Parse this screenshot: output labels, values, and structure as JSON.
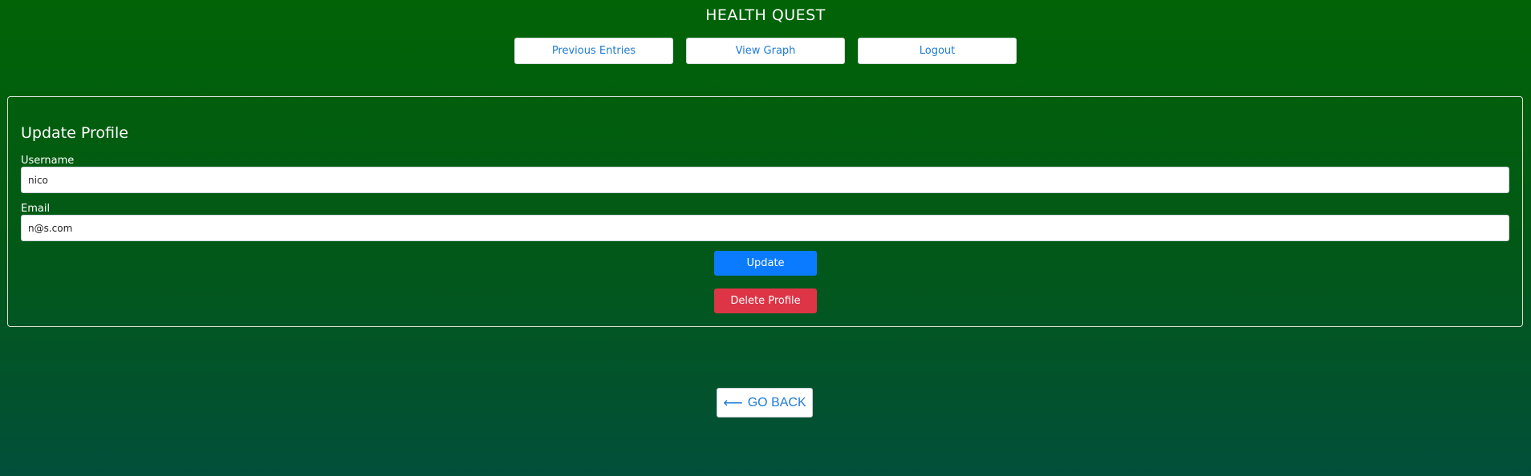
{
  "app": {
    "title": "HEALTH QUEST"
  },
  "nav": {
    "items": [
      {
        "label": "Previous Entries"
      },
      {
        "label": "View Graph"
      },
      {
        "label": "Logout"
      }
    ]
  },
  "profile_form": {
    "title": "Update Profile",
    "username": {
      "label": "Username",
      "value": "nico"
    },
    "email": {
      "label": "Email",
      "value": "n@s.com"
    },
    "update_label": "Update",
    "delete_label": "Delete Profile"
  },
  "back": {
    "label": "GO BACK",
    "icon": "left-arrow-icon",
    "glyph": "⟵"
  },
  "colors": {
    "primary": "#0a7bff",
    "danger": "#dd3446",
    "link": "#1f7ad6"
  }
}
